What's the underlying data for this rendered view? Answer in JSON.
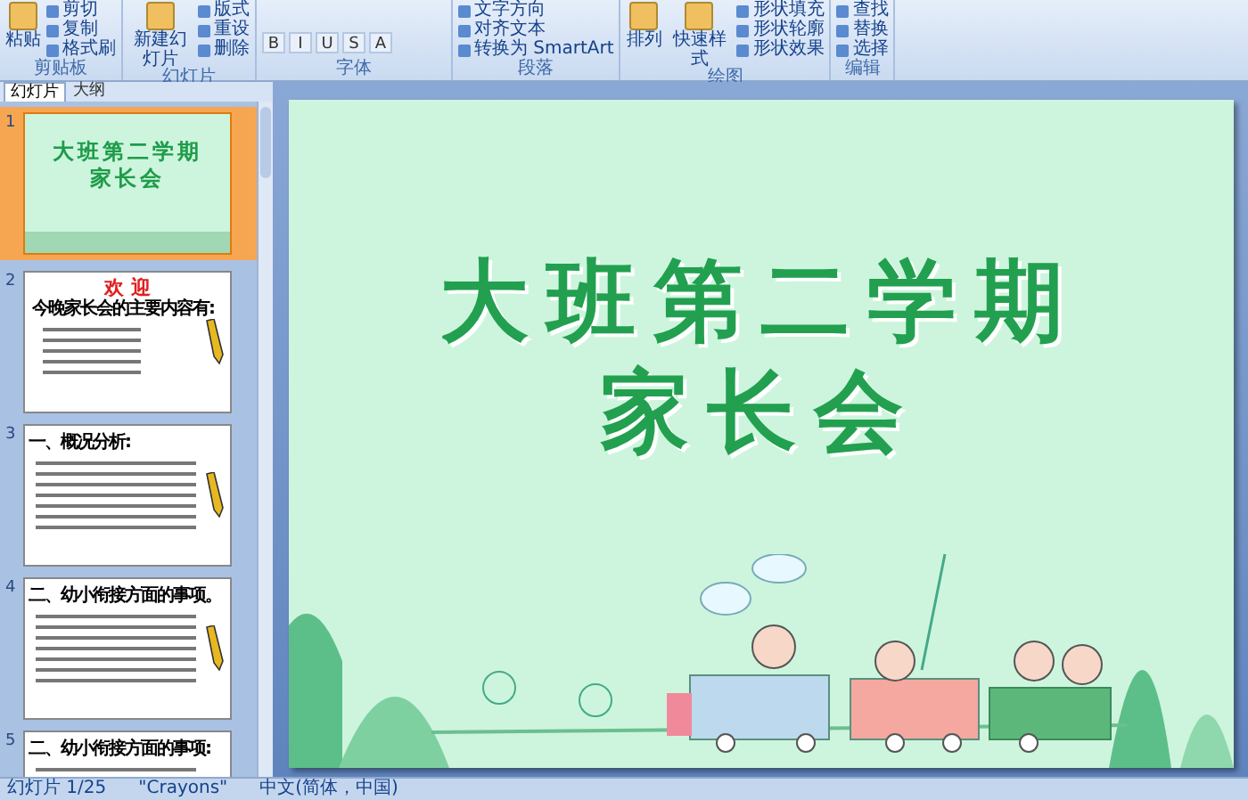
{
  "ribbon": {
    "groups": [
      {
        "label": "剪贴板",
        "buttons": [
          {
            "label": "粘贴",
            "kind": "large"
          },
          {
            "label": "剪切",
            "kind": "small"
          },
          {
            "label": "复制",
            "kind": "small"
          },
          {
            "label": "格式刷",
            "kind": "small"
          }
        ]
      },
      {
        "label": "幻灯片",
        "buttons": [
          {
            "label": "新建幻灯片",
            "kind": "large"
          },
          {
            "label": "版式",
            "kind": "small"
          },
          {
            "label": "重设",
            "kind": "small"
          },
          {
            "label": "删除",
            "kind": "small"
          }
        ]
      },
      {
        "label": "字体",
        "buttons": [
          {
            "label": "B",
            "kind": "tool"
          },
          {
            "label": "I",
            "kind": "tool"
          },
          {
            "label": "U",
            "kind": "tool"
          },
          {
            "label": "S",
            "kind": "tool"
          },
          {
            "label": "A",
            "kind": "tool"
          }
        ]
      },
      {
        "label": "段落",
        "buttons": [
          {
            "label": "文字方向",
            "kind": "small"
          },
          {
            "label": "对齐文本",
            "kind": "small"
          },
          {
            "label": "转换为 SmartArt",
            "kind": "small"
          }
        ]
      },
      {
        "label": "绘图",
        "buttons": [
          {
            "label": "排列",
            "kind": "large"
          },
          {
            "label": "快速样式",
            "kind": "large"
          },
          {
            "label": "形状填充",
            "kind": "small"
          },
          {
            "label": "形状轮廓",
            "kind": "small"
          },
          {
            "label": "形状效果",
            "kind": "small"
          }
        ]
      },
      {
        "label": "编辑",
        "buttons": [
          {
            "label": "查找",
            "kind": "small"
          },
          {
            "label": "替换",
            "kind": "small"
          },
          {
            "label": "选择",
            "kind": "small"
          }
        ]
      }
    ]
  },
  "pane": {
    "tabs": [
      {
        "label": "幻灯片",
        "selected": true
      },
      {
        "label": "大纲",
        "selected": false
      }
    ],
    "slides": [
      {
        "number": "1",
        "kind": "title",
        "selected": true,
        "lines": [
          "大班第二学期",
          "家长会"
        ]
      },
      {
        "number": "2",
        "kind": "welcome",
        "selected": false,
        "heading": "欢 迎",
        "subheading": "今晚家长会的主要内容有:"
      },
      {
        "number": "3",
        "kind": "content",
        "selected": false,
        "heading": "一、概况分析:"
      },
      {
        "number": "4",
        "kind": "content",
        "selected": false,
        "heading": "二、幼小衔接方面的事项。"
      },
      {
        "number": "5",
        "kind": "content",
        "selected": false,
        "heading": "二、幼小衔接方面的事项:"
      }
    ]
  },
  "slide": {
    "title_lines": [
      "大班第二学期",
      "家长会"
    ]
  },
  "status_bar": {
    "slide_count": "幻灯片 1/25",
    "theme": "\"Crayons\"",
    "language": "中文(简体，中国)"
  }
}
